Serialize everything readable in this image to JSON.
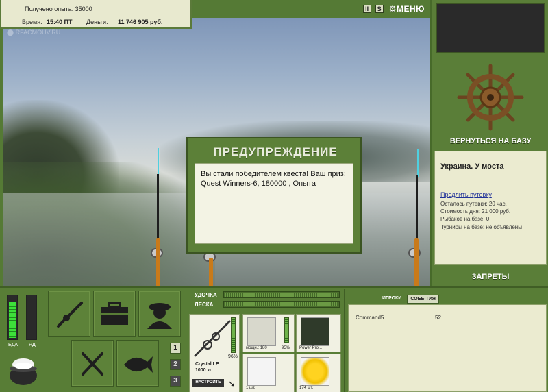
{
  "info": {
    "exp_label": "Получено опыта: 35000",
    "time_label": "Время:",
    "time_value": "15:40 ПТ",
    "money_label": "Деньги:",
    "money_value": "11 746 905 руб.",
    "watermark": "RFACMOUV.RU"
  },
  "toolbar": {
    "pause_label": "II",
    "s_label": "S",
    "menu_label": "МЕНЮ"
  },
  "right_panel": {
    "back_to_base": "ВЕРНУТЬСЯ НА БАЗУ",
    "location_title": "Украина. У моста",
    "extend_link": "Продлить путевку",
    "lines": [
      "Осталось путевки: 20 час.",
      "Стоимость дня: 21 000 руб.",
      "Рыбаков на базе: 0",
      "Турниры на базе: не объявлены"
    ],
    "bans": "ЗАПРЕТЫ"
  },
  "dialog": {
    "title": "ПРЕДУПРЕЖДЕНИЕ",
    "message": "Вы стали победителем квеста! Ваш приз: Quest Winners-6, 180000 , Опыта"
  },
  "meters": {
    "food_label": "ЕДА",
    "poison_label": "ЯД",
    "food_level": 0.85,
    "poison_level": 0.0
  },
  "tabs": [
    "1",
    "2",
    "3"
  ],
  "tackle": {
    "rod_label": "УДОЧКА",
    "line_label": "ЛЕСКА",
    "rod_name": "Crystal LE",
    "rod_capacity": "1000 кг",
    "rod_pct": "96%",
    "setup_button": "НАСТРОИТЬ",
    "reel_power": "мощн.: 180",
    "reel_pct": "95%",
    "line_name": "Power Pro...",
    "hook_count": "1 шт.",
    "bait_count": "174 шт."
  },
  "events": {
    "tab_players": "ИГРОКИ",
    "tab_events": "СОБЫТИЯ",
    "rows": [
      {
        "name": "Command5",
        "value": "52"
      }
    ]
  },
  "colors": {
    "panel_green": "#587d36",
    "panel_light": "#ebebd0",
    "meter_green": "#3de03a",
    "rod_handle": "#c97a1a"
  }
}
